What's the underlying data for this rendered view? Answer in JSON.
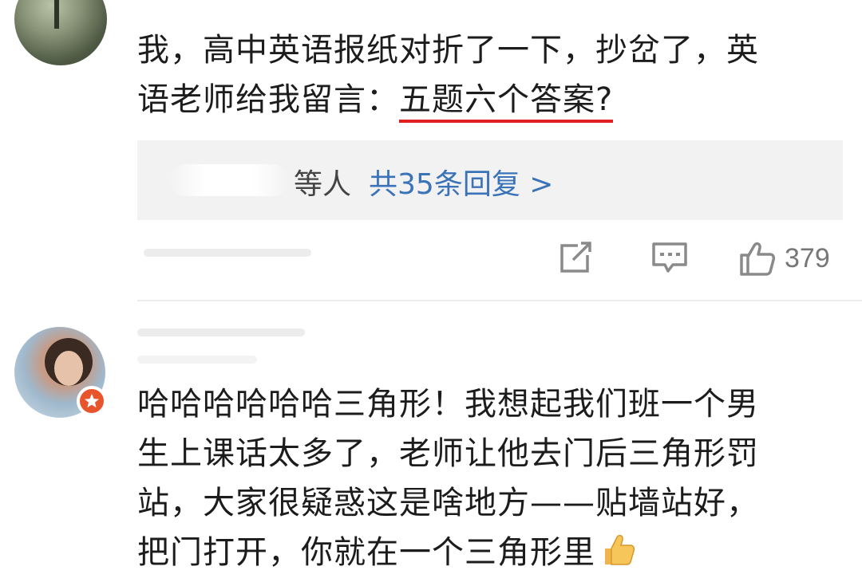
{
  "comment1": {
    "line1": "我，高中英语报纸对折了一下，抄岔了，英",
    "line2_prefix": "语老师给我留言：",
    "line2_highlight": "五题六个答案?"
  },
  "replies": {
    "suffix": "等人",
    "count_label": "共35条回复 >"
  },
  "actions": {
    "share_icon": "share-icon",
    "comment_icon": "comment-icon",
    "like_icon": "thumbs-up-icon",
    "like_count": "379"
  },
  "comment2": {
    "line1": "哈哈哈哈哈哈三角形！我想起我们班一个男",
    "line2": "生上课话太多了，老师让他去门后三角形罚",
    "line3": "站，大家很疑惑这是啥地方——贴墙站好，",
    "line4": "把门打开，你就在一个三角形里"
  },
  "colors": {
    "underline": "#e02020",
    "link": "#3b73b9",
    "badge": "#e8552d"
  }
}
